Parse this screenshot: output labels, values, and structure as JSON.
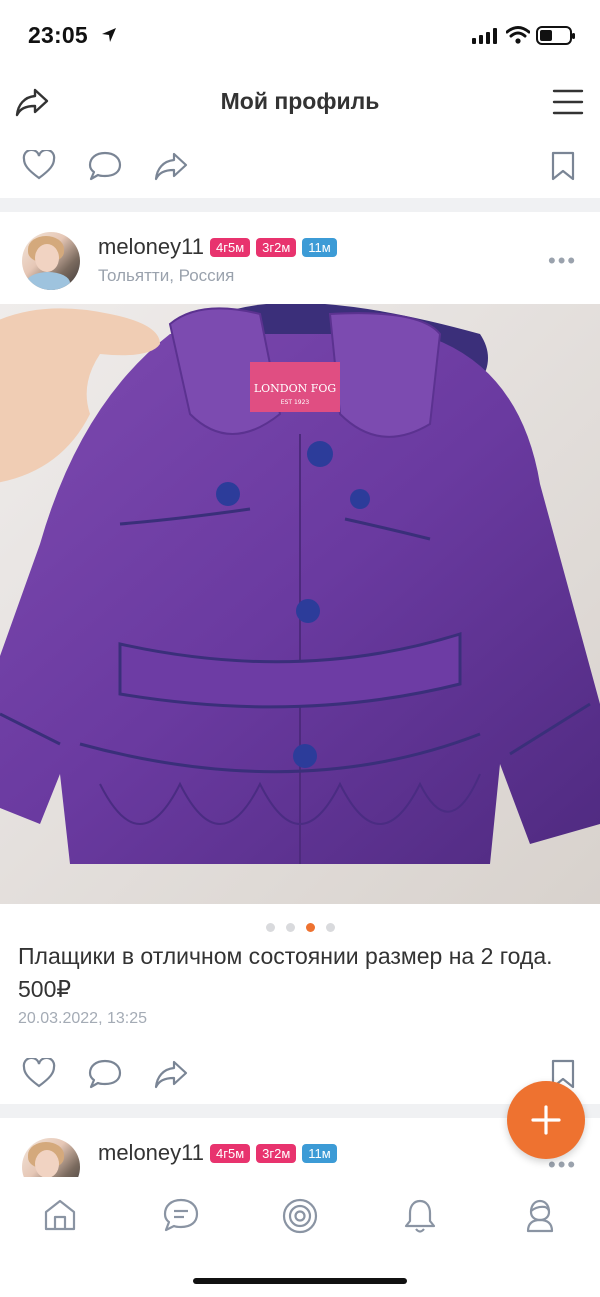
{
  "status_bar": {
    "time": "23:05"
  },
  "header": {
    "title": "Мой профиль"
  },
  "post": {
    "username": "meloney11",
    "badges": [
      "4г5м",
      "3г2м",
      "11м"
    ],
    "location": "Тольятти, Россия",
    "photo": {
      "label_text": "LONDON FOG",
      "label_sub": "EST 1923"
    },
    "carousel": {
      "total": 4,
      "active_index": 3
    },
    "caption": "Плащики в отличном состоянии размер на 2 года. 500₽",
    "date": "20.03.2022, 13:25"
  },
  "next_post": {
    "username": "meloney11",
    "badges": [
      "4г5м",
      "3г2м",
      "11м"
    ]
  },
  "icons": {
    "like": "heart-icon",
    "comment": "comment-icon",
    "share": "share-icon",
    "bookmark": "bookmark-icon",
    "menu": "menu-icon",
    "add": "plus-icon",
    "tabs": [
      "home-icon",
      "messages-icon",
      "target-icon",
      "bell-icon",
      "profile-icon"
    ]
  },
  "colors": {
    "accent": "#ee7230",
    "badge_pink": "#e8336e",
    "badge_blue": "#3c9bd6"
  }
}
